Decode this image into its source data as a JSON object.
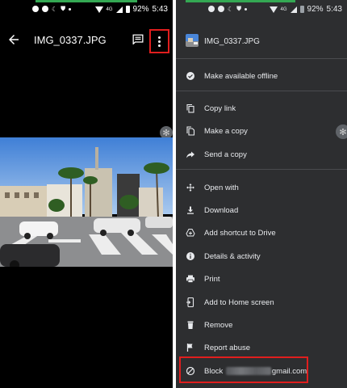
{
  "left_panel": {
    "status_bar": {
      "time": "5:43",
      "battery": "92%",
      "network": "4G"
    },
    "toolbar": {
      "title": "IMG_0337.JPG"
    }
  },
  "right_panel": {
    "status_bar": {
      "time": "5:43",
      "battery": "92%",
      "network": "4G"
    },
    "menu": {
      "header_title": "IMG_0337.JPG",
      "items": [
        {
          "label": "Make available offline",
          "icon": "offline-check-icon"
        },
        {
          "label": "Copy link",
          "icon": "copy-link-icon"
        },
        {
          "label": "Make a copy",
          "icon": "make-copy-icon"
        },
        {
          "label": "Send a copy",
          "icon": "share-arrow-icon"
        },
        {
          "label": "Open with",
          "icon": "open-with-icon"
        },
        {
          "label": "Download",
          "icon": "download-icon"
        },
        {
          "label": "Add shortcut to Drive",
          "icon": "add-shortcut-icon"
        },
        {
          "label": "Details & activity",
          "icon": "info-icon"
        },
        {
          "label": "Print",
          "icon": "print-icon"
        },
        {
          "label": "Add to Home screen",
          "icon": "add-home-screen-icon"
        },
        {
          "label": "Remove",
          "icon": "trash-icon"
        },
        {
          "label": "Report abuse",
          "icon": "report-flag-icon"
        }
      ],
      "block_item": {
        "prefix": "Block",
        "suffix": "gmail.com",
        "icon": "block-icon"
      }
    }
  },
  "colors": {
    "highlight_border": "#e01e1e",
    "menu_background": "#2d2e30",
    "progress_green": "#34a853"
  }
}
